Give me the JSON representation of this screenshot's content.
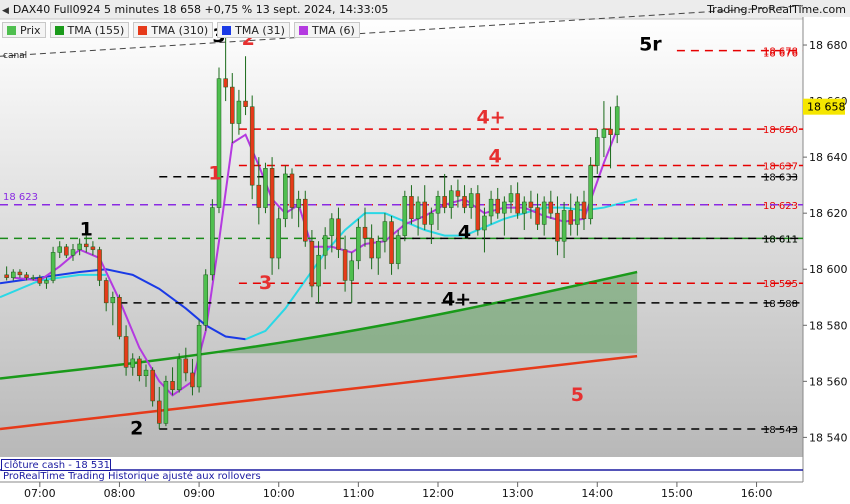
{
  "header": {
    "title": "DAX40 Full0924 5 minutes 18 658 +0,75 % 13 sept. 2024, 14:33:05",
    "source": "Trading.ProRealTime.com"
  },
  "legend": [
    {
      "label": "Prix",
      "color": "#4fbf4f"
    },
    {
      "label": "TMA (155)",
      "color": "#1a9a1a"
    },
    {
      "label": "TMA (310)",
      "color": "#e63a1a"
    },
    {
      "label": "TMA (31)",
      "color": "#1a3ae6"
    },
    {
      "label": "TMA (6)",
      "color": "#b43ae0"
    }
  ],
  "canal_label": "canal",
  "close_box": "clôture cash - 18 531",
  "footer": "ProRealTime Trading Historique ajusté aux rollovers",
  "colors": {
    "bull": "#4fbf4f",
    "bear": "#e63a1a",
    "tma155": "#1a9a1a",
    "tma310": "#e63a1a",
    "tma31_low": "#1a3ae6",
    "tma31_high": "#2ad8e6",
    "tma6": "#b43ae0",
    "red_level": "#e60000",
    "black_level": "#000000",
    "purple_level": "#8a2be2",
    "green_level": "#1a8a1a",
    "price_box": "#f5e600",
    "footer_line": "#1a1aa0"
  },
  "chart_data": {
    "type": "candlestick",
    "title": "DAX40 Full0924 5 minutes",
    "yrange": [
      18533,
      18690
    ],
    "ytick_labels": [
      "18 540",
      "18 560",
      "18 580",
      "18 600",
      "18 620",
      "18 640",
      "18 660",
      "18 680"
    ],
    "ytick_values": [
      18540,
      18560,
      18580,
      18600,
      18620,
      18640,
      18660,
      18680
    ],
    "xtick_labels": [
      "07:00",
      "08:00",
      "09:00",
      "10:00",
      "11:00",
      "12:00",
      "13:00",
      "14:00",
      "15:00",
      "16:00"
    ],
    "last_price": "18 658",
    "levels": [
      {
        "price": 18678,
        "label": "18 678",
        "color": "red",
        "from": "15:00"
      },
      {
        "price": 18678,
        "label": "18 676",
        "color": "red",
        "from": "15:00"
      },
      {
        "price": 18650,
        "label": "18 650",
        "color": "red",
        "from": "09:30"
      },
      {
        "price": 18637,
        "label": "18 637",
        "color": "red",
        "from": "09:30"
      },
      {
        "price": 18633,
        "label": "18 633",
        "color": "black",
        "from": "08:30"
      },
      {
        "price": 18623,
        "label": "18 623",
        "color": "red",
        "from": "09:30"
      },
      {
        "price": 18623,
        "label": "18 623",
        "color": "purple",
        "from": "06:30"
      },
      {
        "price": 18611,
        "label": "18 611",
        "color": "green",
        "from": "06:30"
      },
      {
        "price": 18611,
        "label": "18 611",
        "color": "black",
        "from": "11:30"
      },
      {
        "price": 18595,
        "label": "18 595",
        "color": "red",
        "from": "09:30"
      },
      {
        "price": 18588,
        "label": "18 588",
        "color": "black",
        "from": "08:00"
      },
      {
        "price": 18543,
        "label": "18 543",
        "color": "black",
        "from": "08:30"
      }
    ],
    "annotations": [
      {
        "text": "1",
        "color": "black",
        "time": "07:35",
        "price": 18612
      },
      {
        "text": "2",
        "color": "black",
        "time": "08:13",
        "price": 18541
      },
      {
        "text": "3",
        "color": "black",
        "time": "09:15",
        "price": 18681
      },
      {
        "text": "2",
        "color": "red",
        "time": "09:37",
        "price": 18680
      },
      {
        "text": "1",
        "color": "red",
        "time": "09:12",
        "price": 18632
      },
      {
        "text": "3",
        "color": "red",
        "time": "09:50",
        "price": 18593
      },
      {
        "text": "4",
        "color": "black",
        "time": "12:20",
        "price": 18611
      },
      {
        "text": "4+",
        "color": "black",
        "time": "12:14",
        "price": 18587
      },
      {
        "text": "4",
        "color": "red",
        "time": "12:43",
        "price": 18638
      },
      {
        "text": "4+",
        "color": "red",
        "time": "12:40",
        "price": 18652
      },
      {
        "text": "5r",
        "color": "black",
        "time": "14:40",
        "price": 18678
      },
      {
        "text": "5",
        "color": "red",
        "time": "13:45",
        "price": 18553
      }
    ],
    "candles": [
      {
        "t": "06:35",
        "o": 18598,
        "h": 18601,
        "l": 18596,
        "c": 18597
      },
      {
        "t": "06:40",
        "o": 18597,
        "h": 18600,
        "l": 18596,
        "c": 18599
      },
      {
        "t": "06:45",
        "o": 18599,
        "h": 18600,
        "l": 18597,
        "c": 18598
      },
      {
        "t": "06:50",
        "o": 18598,
        "h": 18599,
        "l": 18596,
        "c": 18597
      },
      {
        "t": "06:55",
        "o": 18597,
        "h": 18598,
        "l": 18596,
        "c": 18597
      },
      {
        "t": "07:00",
        "o": 18597,
        "h": 18598,
        "l": 18594,
        "c": 18595
      },
      {
        "t": "07:05",
        "o": 18595,
        "h": 18597,
        "l": 18593,
        "c": 18596
      },
      {
        "t": "07:10",
        "o": 18596,
        "h": 18608,
        "l": 18595,
        "c": 18606
      },
      {
        "t": "07:15",
        "o": 18606,
        "h": 18610,
        "l": 18604,
        "c": 18608
      },
      {
        "t": "07:20",
        "o": 18608,
        "h": 18609,
        "l": 18604,
        "c": 18605
      },
      {
        "t": "07:25",
        "o": 18605,
        "h": 18609,
        "l": 18603,
        "c": 18607
      },
      {
        "t": "07:30",
        "o": 18607,
        "h": 18611,
        "l": 18605,
        "c": 18609
      },
      {
        "t": "07:35",
        "o": 18609,
        "h": 18612,
        "l": 18606,
        "c": 18608
      },
      {
        "t": "07:40",
        "o": 18608,
        "h": 18610,
        "l": 18605,
        "c": 18607
      },
      {
        "t": "07:45",
        "o": 18607,
        "h": 18608,
        "l": 18594,
        "c": 18596
      },
      {
        "t": "07:50",
        "o": 18596,
        "h": 18597,
        "l": 18585,
        "c": 18588
      },
      {
        "t": "07:55",
        "o": 18588,
        "h": 18592,
        "l": 18580,
        "c": 18590
      },
      {
        "t": "08:00",
        "o": 18590,
        "h": 18591,
        "l": 18575,
        "c": 18576
      },
      {
        "t": "08:05",
        "o": 18576,
        "h": 18580,
        "l": 18562,
        "c": 18565
      },
      {
        "t": "08:10",
        "o": 18565,
        "h": 18570,
        "l": 18562,
        "c": 18568
      },
      {
        "t": "08:15",
        "o": 18568,
        "h": 18569,
        "l": 18560,
        "c": 18562
      },
      {
        "t": "08:20",
        "o": 18562,
        "h": 18566,
        "l": 18558,
        "c": 18564
      },
      {
        "t": "08:25",
        "o": 18564,
        "h": 18565,
        "l": 18551,
        "c": 18553
      },
      {
        "t": "08:30",
        "o": 18553,
        "h": 18558,
        "l": 18543,
        "c": 18545
      },
      {
        "t": "08:35",
        "o": 18545,
        "h": 18562,
        "l": 18544,
        "c": 18560
      },
      {
        "t": "08:40",
        "o": 18560,
        "h": 18565,
        "l": 18555,
        "c": 18557
      },
      {
        "t": "08:45",
        "o": 18557,
        "h": 18570,
        "l": 18556,
        "c": 18568
      },
      {
        "t": "08:50",
        "o": 18568,
        "h": 18572,
        "l": 18560,
        "c": 18563
      },
      {
        "t": "08:55",
        "o": 18563,
        "h": 18568,
        "l": 18555,
        "c": 18558
      },
      {
        "t": "09:00",
        "o": 18558,
        "h": 18582,
        "l": 18556,
        "c": 18580
      },
      {
        "t": "09:05",
        "o": 18580,
        "h": 18600,
        "l": 18578,
        "c": 18598
      },
      {
        "t": "09:10",
        "o": 18598,
        "h": 18625,
        "l": 18596,
        "c": 18622
      },
      {
        "t": "09:15",
        "o": 18622,
        "h": 18672,
        "l": 18620,
        "c": 18668
      },
      {
        "t": "09:20",
        "o": 18668,
        "h": 18685,
        "l": 18660,
        "c": 18665
      },
      {
        "t": "09:25",
        "o": 18665,
        "h": 18670,
        "l": 18645,
        "c": 18652
      },
      {
        "t": "09:30",
        "o": 18652,
        "h": 18664,
        "l": 18648,
        "c": 18660
      },
      {
        "t": "09:35",
        "o": 18660,
        "h": 18676,
        "l": 18655,
        "c": 18658
      },
      {
        "t": "09:40",
        "o": 18658,
        "h": 18662,
        "l": 18625,
        "c": 18630
      },
      {
        "t": "09:45",
        "o": 18630,
        "h": 18640,
        "l": 18616,
        "c": 18622
      },
      {
        "t": "09:50",
        "o": 18622,
        "h": 18638,
        "l": 18620,
        "c": 18636
      },
      {
        "t": "09:55",
        "o": 18636,
        "h": 18640,
        "l": 18598,
        "c": 18604
      },
      {
        "t": "10:00",
        "o": 18604,
        "h": 18622,
        "l": 18600,
        "c": 18618
      },
      {
        "t": "10:05",
        "o": 18618,
        "h": 18637,
        "l": 18615,
        "c": 18634
      },
      {
        "t": "10:10",
        "o": 18634,
        "h": 18636,
        "l": 18618,
        "c": 18622
      },
      {
        "t": "10:15",
        "o": 18622,
        "h": 18628,
        "l": 18615,
        "c": 18625
      },
      {
        "t": "10:20",
        "o": 18625,
        "h": 18628,
        "l": 18608,
        "c": 18610
      },
      {
        "t": "10:25",
        "o": 18610,
        "h": 18614,
        "l": 18590,
        "c": 18594
      },
      {
        "t": "10:30",
        "o": 18594,
        "h": 18610,
        "l": 18588,
        "c": 18605
      },
      {
        "t": "10:35",
        "o": 18605,
        "h": 18615,
        "l": 18600,
        "c": 18612
      },
      {
        "t": "10:40",
        "o": 18612,
        "h": 18620,
        "l": 18606,
        "c": 18618
      },
      {
        "t": "10:45",
        "o": 18618,
        "h": 18622,
        "l": 18604,
        "c": 18607
      },
      {
        "t": "10:50",
        "o": 18607,
        "h": 18612,
        "l": 18592,
        "c": 18596
      },
      {
        "t": "10:55",
        "o": 18596,
        "h": 18606,
        "l": 18588,
        "c": 18603
      },
      {
        "t": "11:00",
        "o": 18603,
        "h": 18618,
        "l": 18600,
        "c": 18615
      },
      {
        "t": "11:05",
        "o": 18615,
        "h": 18622,
        "l": 18608,
        "c": 18611
      },
      {
        "t": "11:10",
        "o": 18611,
        "h": 18616,
        "l": 18600,
        "c": 18604
      },
      {
        "t": "11:15",
        "o": 18604,
        "h": 18612,
        "l": 18598,
        "c": 18610
      },
      {
        "t": "11:20",
        "o": 18610,
        "h": 18620,
        "l": 18606,
        "c": 18617
      },
      {
        "t": "11:25",
        "o": 18617,
        "h": 18619,
        "l": 18598,
        "c": 18602
      },
      {
        "t": "11:30",
        "o": 18602,
        "h": 18614,
        "l": 18600,
        "c": 18612
      },
      {
        "t": "11:35",
        "o": 18612,
        "h": 18628,
        "l": 18610,
        "c": 18626
      },
      {
        "t": "11:40",
        "o": 18626,
        "h": 18630,
        "l": 18616,
        "c": 18618
      },
      {
        "t": "11:45",
        "o": 18618,
        "h": 18626,
        "l": 18612,
        "c": 18624
      },
      {
        "t": "11:50",
        "o": 18624,
        "h": 18630,
        "l": 18614,
        "c": 18616
      },
      {
        "t": "11:55",
        "o": 18616,
        "h": 18622,
        "l": 18609,
        "c": 18620
      },
      {
        "t": "12:00",
        "o": 18620,
        "h": 18628,
        "l": 18614,
        "c": 18626
      },
      {
        "t": "12:05",
        "o": 18626,
        "h": 18634,
        "l": 18620,
        "c": 18622
      },
      {
        "t": "12:10",
        "o": 18622,
        "h": 18630,
        "l": 18618,
        "c": 18628
      },
      {
        "t": "12:15",
        "o": 18628,
        "h": 18632,
        "l": 18622,
        "c": 18626
      },
      {
        "t": "12:20",
        "o": 18626,
        "h": 18630,
        "l": 18620,
        "c": 18622
      },
      {
        "t": "12:25",
        "o": 18622,
        "h": 18629,
        "l": 18618,
        "c": 18627
      },
      {
        "t": "12:30",
        "o": 18627,
        "h": 18630,
        "l": 18612,
        "c": 18614
      },
      {
        "t": "12:35",
        "o": 18614,
        "h": 18622,
        "l": 18606,
        "c": 18619
      },
      {
        "t": "12:40",
        "o": 18619,
        "h": 18628,
        "l": 18616,
        "c": 18625
      },
      {
        "t": "12:45",
        "o": 18625,
        "h": 18629,
        "l": 18618,
        "c": 18620
      },
      {
        "t": "12:50",
        "o": 18620,
        "h": 18626,
        "l": 18612,
        "c": 18624
      },
      {
        "t": "12:55",
        "o": 18624,
        "h": 18630,
        "l": 18620,
        "c": 18627
      },
      {
        "t": "13:00",
        "o": 18627,
        "h": 18631,
        "l": 18618,
        "c": 18620
      },
      {
        "t": "13:05",
        "o": 18620,
        "h": 18626,
        "l": 18614,
        "c": 18624
      },
      {
        "t": "13:10",
        "o": 18624,
        "h": 18628,
        "l": 18618,
        "c": 18622
      },
      {
        "t": "13:15",
        "o": 18622,
        "h": 18627,
        "l": 18614,
        "c": 18616
      },
      {
        "t": "13:20",
        "o": 18616,
        "h": 18626,
        "l": 18612,
        "c": 18624
      },
      {
        "t": "13:25",
        "o": 18624,
        "h": 18628,
        "l": 18618,
        "c": 18620
      },
      {
        "t": "13:30",
        "o": 18620,
        "h": 18626,
        "l": 18605,
        "c": 18610
      },
      {
        "t": "13:35",
        "o": 18610,
        "h": 18624,
        "l": 18604,
        "c": 18621
      },
      {
        "t": "13:40",
        "o": 18621,
        "h": 18627,
        "l": 18612,
        "c": 18616
      },
      {
        "t": "13:45",
        "o": 18616,
        "h": 18626,
        "l": 18612,
        "c": 18624
      },
      {
        "t": "13:50",
        "o": 18624,
        "h": 18628,
        "l": 18614,
        "c": 18618
      },
      {
        "t": "13:55",
        "o": 18618,
        "h": 18640,
        "l": 18616,
        "c": 18637
      },
      {
        "t": "14:00",
        "o": 18637,
        "h": 18650,
        "l": 18634,
        "c": 18647
      },
      {
        "t": "14:05",
        "o": 18647,
        "h": 18660,
        "l": 18640,
        "c": 18650
      },
      {
        "t": "14:10",
        "o": 18650,
        "h": 18658,
        "l": 18636,
        "c": 18648
      },
      {
        "t": "14:15",
        "o": 18648,
        "h": 18662,
        "l": 18645,
        "c": 18658
      }
    ]
  }
}
